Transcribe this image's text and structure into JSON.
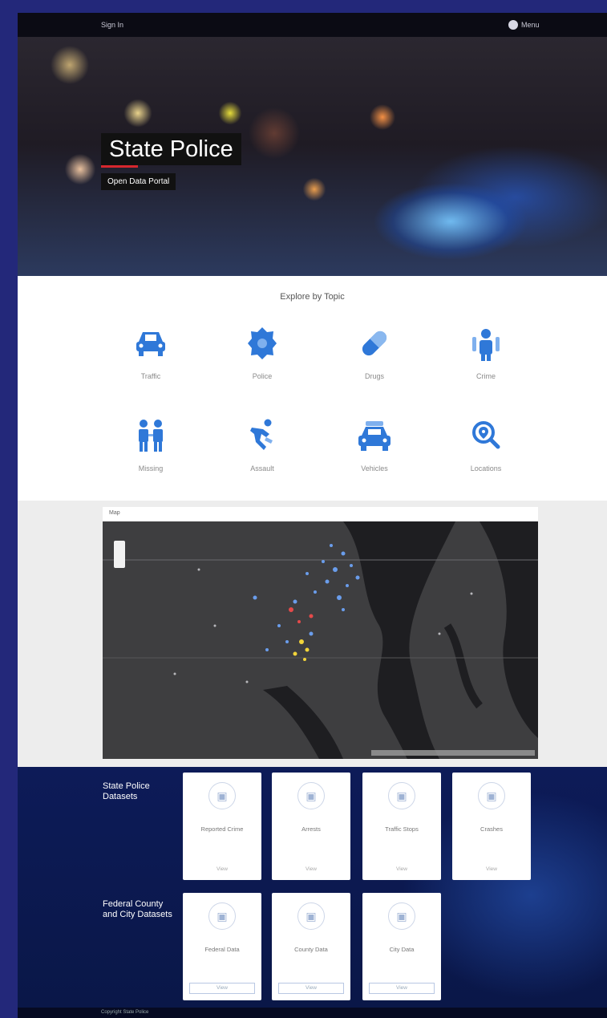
{
  "topbar": {
    "brand": "Sign In",
    "user": "Menu"
  },
  "hero": {
    "title": "State Police",
    "subtitle": "Open Data Portal"
  },
  "topics": {
    "heading": "Explore by Topic",
    "items": [
      {
        "label": "Traffic",
        "icon": "car-crash-icon"
      },
      {
        "label": "Police",
        "icon": "police-badge-icon"
      },
      {
        "label": "Drugs",
        "icon": "pill-icon"
      },
      {
        "label": "Crime",
        "icon": "person-icon"
      },
      {
        "label": "Missing",
        "icon": "family-icon"
      },
      {
        "label": "Assault",
        "icon": "fall-icon"
      },
      {
        "label": "Vehicles",
        "icon": "vehicle-icon"
      },
      {
        "label": "Locations",
        "icon": "location-search-icon"
      }
    ]
  },
  "map": {
    "title": "Map"
  },
  "datasets": {
    "group1": {
      "label": "State Police Datasets",
      "cards": [
        {
          "title": "Reported Crime",
          "link": "View"
        },
        {
          "title": "Arrests",
          "link": "View"
        },
        {
          "title": "Traffic Stops",
          "link": "View"
        },
        {
          "title": "Crashes",
          "link": "View"
        }
      ]
    },
    "group2": {
      "label": "Federal County and City Datasets",
      "cards": [
        {
          "title": "Federal Data",
          "button": "View"
        },
        {
          "title": "County Data",
          "button": "View"
        },
        {
          "title": "City Data",
          "button": "View"
        }
      ]
    }
  },
  "footer": {
    "text": "Copyright State Police"
  },
  "colors": {
    "frame_bg": "#23287a",
    "icon_blue": "#2f78d8",
    "dataset_bg": "#0d1b58",
    "map_bg": "#3c3c3e"
  }
}
